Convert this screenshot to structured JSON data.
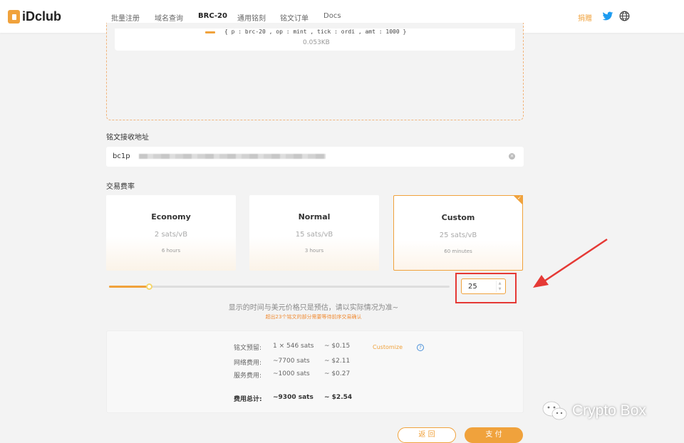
{
  "nav": {
    "logo": "iDclub",
    "items": [
      "批量注册",
      "域名查询",
      "BRC-20",
      "通用铭刻",
      "铭文订单",
      "Docs"
    ],
    "donate": "捐赠"
  },
  "file": {
    "code": "{ p : brc-20 , op : mint , tick : ordi , amt : 1000 }",
    "size": "0.053KB"
  },
  "address": {
    "label": "铭文接收地址",
    "value": "bc1p"
  },
  "fee": {
    "label": "交易费率",
    "options": [
      {
        "title": "Economy",
        "rate": "2 sats/vB",
        "time": "6 hours"
      },
      {
        "title": "Normal",
        "rate": "15 sats/vB",
        "time": "3 hours"
      },
      {
        "title": "Custom",
        "rate": "25 sats/vB",
        "time": "60 minutes"
      }
    ],
    "selected": "Custom",
    "slider_level": 0.12,
    "custom_value": "25"
  },
  "notes": {
    "main": "显示的时间与美元价格只是预估，请以实际情况为准~",
    "warning": "超出23个铭文的部分需要等待前序交易确认"
  },
  "summary": {
    "rows": [
      {
        "label": "铭文预留:",
        "sats": "1 × 546  sats",
        "usd": "~ $0.15"
      },
      {
        "label": "网络费用:",
        "sats": "~7700  sats",
        "usd": "~ $2.11"
      },
      {
        "label": "服务费用:",
        "sats": "~1000  sats",
        "usd": "~ $0.27"
      }
    ],
    "total_label": "费用总计:",
    "total_sats": "~9300  sats",
    "total_usd": "~ $2.54",
    "customize": "Customize",
    "help": "?"
  },
  "buttons": {
    "back": "返 回",
    "pay": "支 付"
  },
  "watermark": "Crypto Box",
  "colors": {
    "accent": "#f0a23c",
    "highlight": "#e53935",
    "twitter": "#1d9bf0"
  }
}
